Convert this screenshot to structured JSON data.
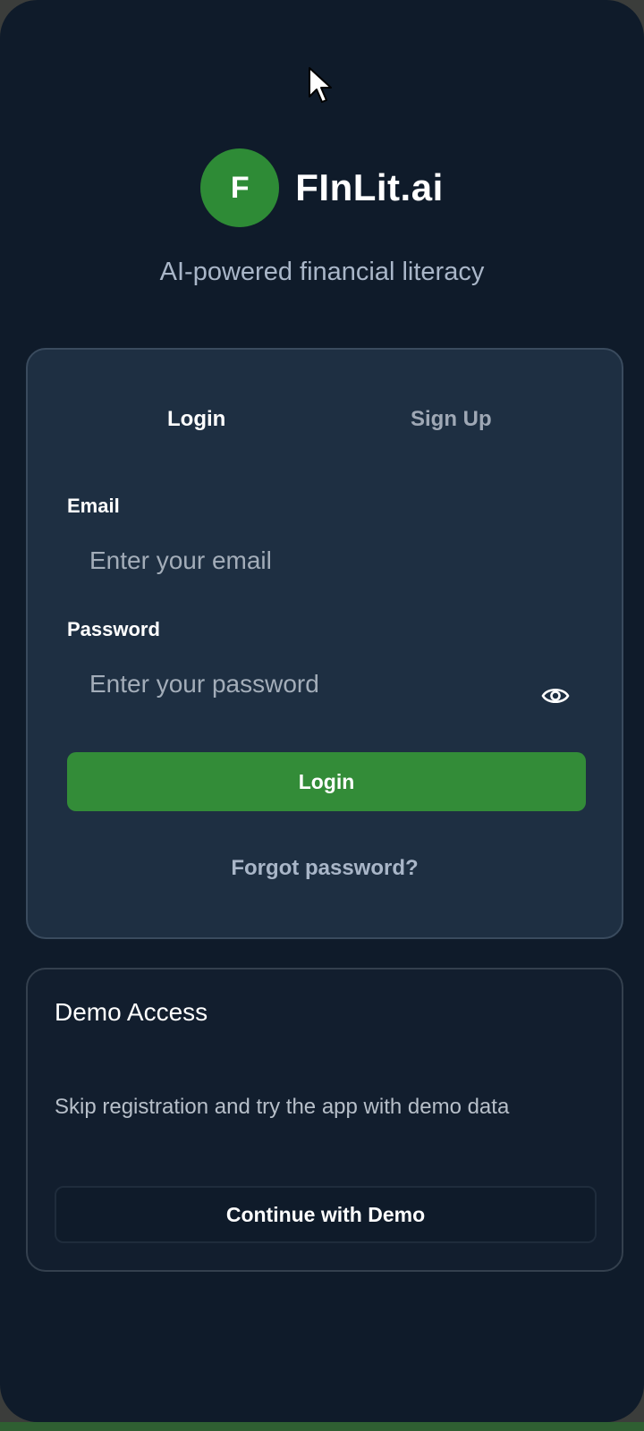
{
  "brand": {
    "logo_letter": "F",
    "name": "FInLit.ai",
    "tagline": "AI-powered financial literacy",
    "accent_color": "#2e8b36"
  },
  "auth": {
    "tabs": [
      {
        "label": "Login",
        "active": true
      },
      {
        "label": "Sign Up",
        "active": false
      }
    ],
    "email": {
      "label": "Email",
      "value": "",
      "placeholder": "Enter your email"
    },
    "password": {
      "label": "Password",
      "value": "",
      "placeholder": "Enter your password",
      "toggle_icon": "eye-icon"
    },
    "submit_label": "Login",
    "forgot_label": "Forgot password?"
  },
  "demo": {
    "title": "Demo Access",
    "description": "Skip registration and try the app with demo data",
    "button_label": "Continue with Demo"
  },
  "icons": {
    "cursor": "mouse-pointer-icon"
  }
}
